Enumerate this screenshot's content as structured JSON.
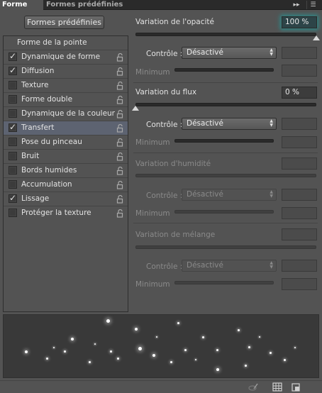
{
  "tabs": [
    {
      "label": "Forme"
    },
    {
      "label": "Formes prédéfinies"
    }
  ],
  "tab_controls": {
    "expand_icon": "double-arrow-right-icon",
    "menu_icon": "panel-menu-icon"
  },
  "preset_button": {
    "label": "Formes prédéfinies"
  },
  "list": {
    "header": "Forme de la pointe",
    "items": [
      {
        "label": "Dynamique de forme",
        "checked": true,
        "selected": false
      },
      {
        "label": "Diffusion",
        "checked": true,
        "selected": false
      },
      {
        "label": "Texture",
        "checked": false,
        "selected": false
      },
      {
        "label": "Forme double",
        "checked": false,
        "selected": false
      },
      {
        "label": "Dynamique de la couleur",
        "checked": false,
        "selected": false
      },
      {
        "label": "Transfert",
        "checked": true,
        "selected": true
      },
      {
        "label": "Pose du pinceau",
        "checked": false,
        "selected": false
      },
      {
        "label": "Bruit",
        "checked": false,
        "selected": false
      },
      {
        "label": "Bords humides",
        "checked": false,
        "selected": false
      },
      {
        "label": "Accumulation",
        "checked": false,
        "selected": false
      },
      {
        "label": "Lissage",
        "checked": true,
        "selected": false
      },
      {
        "label": "Protéger la texture",
        "checked": false,
        "selected": false
      }
    ]
  },
  "settings": {
    "opacity": {
      "label": "Variation de l'opacité",
      "value": "100 %",
      "slider_fraction": 1.0,
      "control_label": "Contrôle :",
      "control_value": "Désactivé",
      "minimum_label": "Minimum"
    },
    "flow": {
      "label": "Variation du flux",
      "value": "0 %",
      "slider_fraction": 0.0,
      "control_label": "Contrôle :",
      "control_value": "Désactivé",
      "minimum_label": "Minimum"
    },
    "wetness": {
      "label": "Variation d'humidité",
      "control_label": "Contrôle :",
      "control_value": "Désactivé",
      "minimum_label": "Minimum",
      "disabled": true
    },
    "mix": {
      "label": "Variation de mélange",
      "control_label": "Contrôle :",
      "control_value": "Désactivé",
      "minimum_label": "Minimum",
      "disabled": true
    }
  },
  "bottom_icons": [
    "brush-toggle-icon",
    "grid-icon",
    "new-preset-icon"
  ],
  "colors": {
    "panel": "#535353",
    "selected_row": "#5d6371",
    "focus_glow": "#2c8a8a"
  }
}
